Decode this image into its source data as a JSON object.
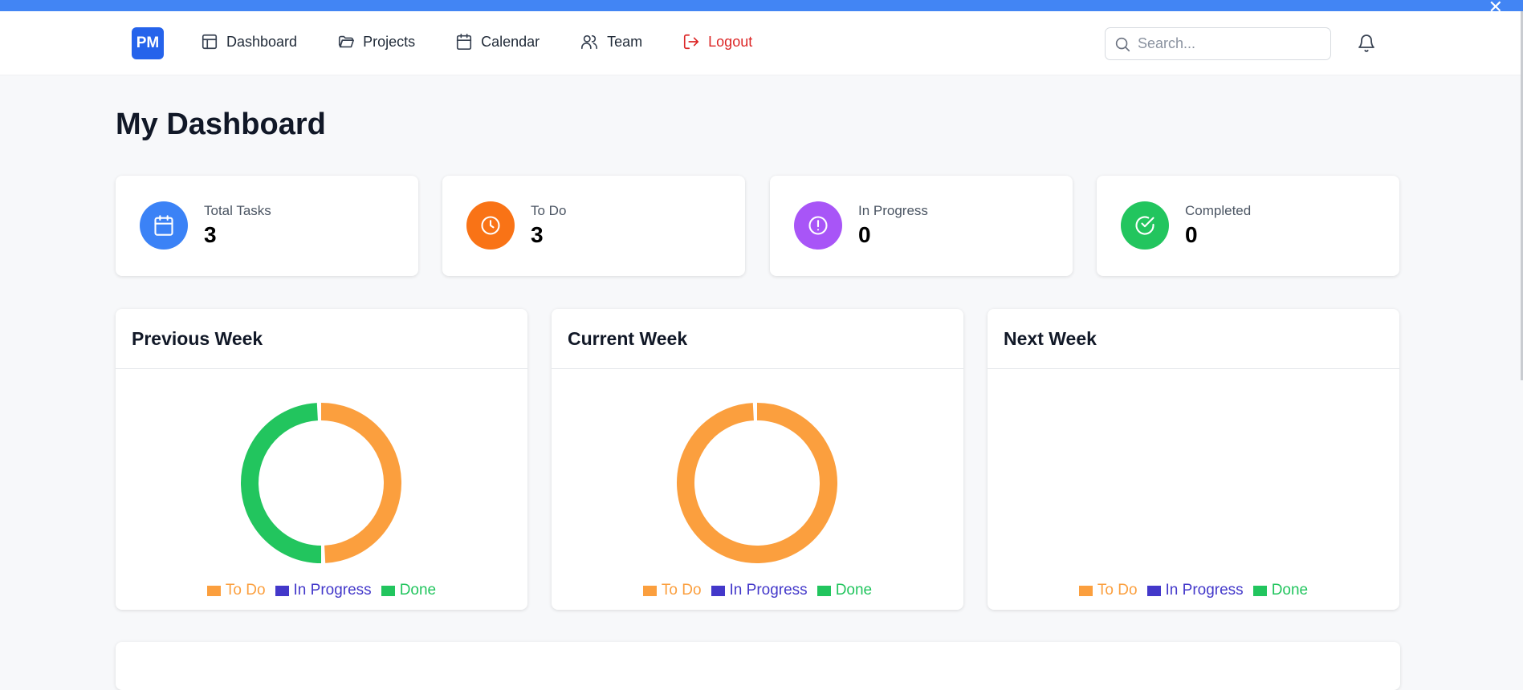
{
  "window": {
    "close_glyph": "✕"
  },
  "nav": {
    "logo": "PM",
    "items": [
      {
        "label": "Dashboard",
        "icon": "layout-icon"
      },
      {
        "label": "Projects",
        "icon": "folder-icon"
      },
      {
        "label": "Calendar",
        "icon": "calendar-icon"
      },
      {
        "label": "Team",
        "icon": "users-icon"
      },
      {
        "label": "Logout",
        "icon": "logout-icon"
      }
    ],
    "search_placeholder": "Search...",
    "colors": {
      "brand": "#2563eb",
      "logout": "#dc2626",
      "topbar": "#4285f4"
    }
  },
  "page": {
    "title": "My Dashboard"
  },
  "stats": [
    {
      "label": "Total Tasks",
      "value": "3",
      "icon": "calendar-icon",
      "color": "#3b82f6"
    },
    {
      "label": "To Do",
      "value": "3",
      "icon": "clock-icon",
      "color": "#f97316"
    },
    {
      "label": "In Progress",
      "value": "0",
      "icon": "alert-circle-icon",
      "color": "#a855f7"
    },
    {
      "label": "Completed",
      "value": "0",
      "icon": "check-circle-icon",
      "color": "#22c55e"
    }
  ],
  "weeks": [
    {
      "title": "Previous Week"
    },
    {
      "title": "Current Week"
    },
    {
      "title": "Next Week"
    }
  ],
  "legend": {
    "todo": "To Do",
    "in_progress": "In Progress",
    "done": "Done"
  },
  "chart_data": [
    {
      "type": "pie",
      "title": "Previous Week",
      "categories": [
        "To Do",
        "In Progress",
        "Done"
      ],
      "values": [
        1,
        0,
        1
      ],
      "colors": [
        "#fb9f3e",
        "#4338ca",
        "#22c55e"
      ]
    },
    {
      "type": "pie",
      "title": "Current Week",
      "categories": [
        "To Do",
        "In Progress",
        "Done"
      ],
      "values": [
        2,
        0,
        0
      ],
      "colors": [
        "#fb9f3e",
        "#4338ca",
        "#22c55e"
      ]
    },
    {
      "type": "pie",
      "title": "Next Week",
      "categories": [
        "To Do",
        "In Progress",
        "Done"
      ],
      "values": [
        0,
        0,
        0
      ],
      "colors": [
        "#fb9f3e",
        "#4338ca",
        "#22c55e"
      ]
    }
  ]
}
